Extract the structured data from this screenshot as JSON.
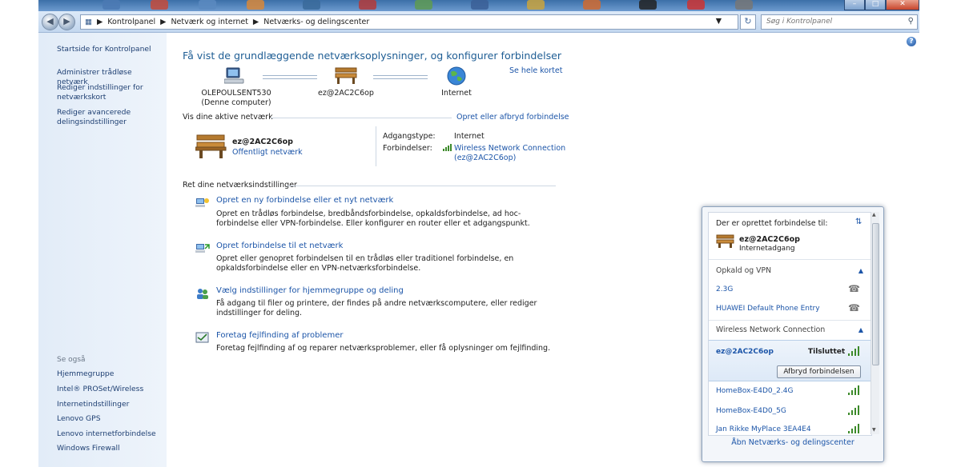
{
  "colors": {
    "link": "#1c55a8",
    "title": "#1e5d94",
    "signal": "#3c8a2a"
  },
  "address": {
    "crumbs": [
      "Kontrolpanel",
      "Netværk og internet",
      "Netværks- og delingscenter"
    ],
    "search_placeholder": "Søg i Kontrolpanel"
  },
  "window_controls": {
    "minimize": "–",
    "maximize": "□",
    "close": "✕"
  },
  "left_pane": {
    "home": "Startside for Kontrolpanel",
    "links": [
      "Administrer trådløse netværk",
      "Rediger indstillinger for netværkskort",
      "Rediger avancerede delingsindstillinger"
    ],
    "see_also_label": "Se også",
    "see_also": [
      "Hjemmegruppe",
      "Intel® PROSet/Wireless",
      "Internetindstillinger",
      "Lenovo GPS",
      "Lenovo internetforbindelse",
      "Windows Firewall"
    ]
  },
  "main": {
    "title": "Få vist de grundlæggende netværksoplysninger, og konfigurer forbindelser",
    "see_full_map": "Se hele kortet",
    "map": {
      "computer_name": "OLEPOULSENT530",
      "computer_sub": "(Denne computer)",
      "network_name": "ez@2AC2C6op",
      "internet": "Internet"
    },
    "active_header": "Vis dine aktive netværk",
    "connect_link": "Opret eller afbryd forbindelse",
    "active_network": {
      "name": "ez@2AC2C6op",
      "type": "Offentligt netværk",
      "access_label": "Adgangstype:",
      "access_value": "Internet",
      "conn_label": "Forbindelser:",
      "conn_value_1": "Wireless Network Connection",
      "conn_value_2": "(ez@2AC2C6op)"
    },
    "settings_header": "Ret dine netværksindstillinger",
    "tasks": [
      {
        "title": "Opret en ny forbindelse eller et nyt netværk",
        "desc": "Opret en trådløs forbindelse, bredbåndsforbindelse, opkaldsforbindelse, ad hoc-forbindelse eller VPN-forbindelse. Eller konfigurer en router eller et adgangspunkt."
      },
      {
        "title": "Opret forbindelse til et netværk",
        "desc": "Opret eller genopret forbindelsen til en trådløs eller traditionel forbindelse, en opkaldsforbindelse eller en VPN-netværksforbindelse."
      },
      {
        "title": "Vælg indstillinger for hjemmegruppe og deling",
        "desc": "Få adgang til filer og printere, der findes på andre netværkscomputere, eller rediger indstillinger for deling."
      },
      {
        "title": "Foretag fejlfinding af problemer",
        "desc": "Foretag fejlfinding af og reparer netværksproblemer, eller få oplysninger om fejlfinding."
      }
    ]
  },
  "popup": {
    "header": "Der er oprettet forbindelse til:",
    "current_name": "ez@2AC2C6op",
    "current_sub": "Internetadgang",
    "group1": "Opkald og VPN",
    "group1_items": [
      "2.3G",
      "HUAWEI Default Phone Entry"
    ],
    "group2": "Wireless Network Connection",
    "connected_name": "ez@2AC2C6op",
    "connected_status": "Tilsluttet",
    "disconnect_button": "Afbryd forbindelsen",
    "networks": [
      "HomeBox-E4D0_2.4G",
      "HomeBox-E4D0_5G",
      "Jan Rikke MyPlace 3EA4E4"
    ],
    "open_center": "Åbn Netværks- og delingscenter"
  }
}
